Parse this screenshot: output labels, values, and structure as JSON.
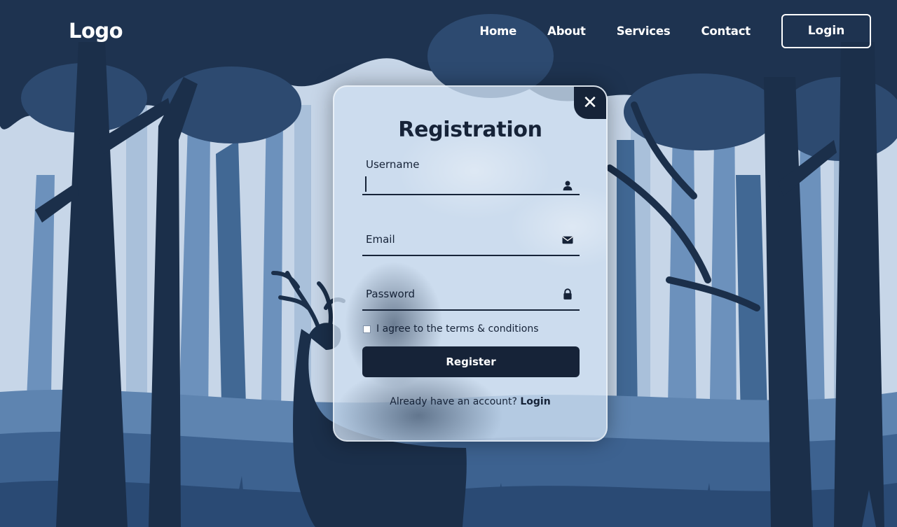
{
  "header": {
    "logo": "Logo",
    "nav": [
      "Home",
      "About",
      "Services",
      "Contact"
    ],
    "login_button": "Login"
  },
  "form": {
    "title": "Registration",
    "close_glyph": "✕",
    "fields": [
      {
        "label": "Username",
        "icon": "person-icon",
        "value": ""
      },
      {
        "label": "Email",
        "icon": "mail-icon",
        "value": ""
      },
      {
        "label": "Password",
        "icon": "lock-icon",
        "value": ""
      }
    ],
    "terms_text": "I agree to the terms & conditions",
    "terms_checked": false,
    "register_button": "Register",
    "account_prompt": "Already have an account?",
    "login_link": "Login"
  },
  "colors": {
    "dark_navy": "#162338",
    "sky": "#c7d6e8",
    "text_white": "#ffffff"
  }
}
